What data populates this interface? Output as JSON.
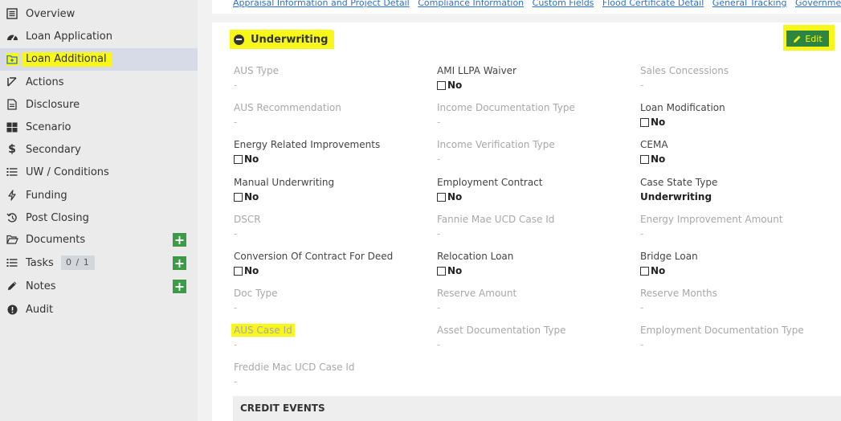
{
  "sidebar": {
    "items": [
      {
        "label": "Overview",
        "icon": "list-alt-icon"
      },
      {
        "label": "Loan Application",
        "icon": "tachometer-icon"
      },
      {
        "label": "Loan Additional",
        "icon": "folder-plus-icon"
      },
      {
        "label": "Actions",
        "icon": "arrow-up-right-icon"
      },
      {
        "label": "Disclosure",
        "icon": "document-icon"
      },
      {
        "label": "Scenario",
        "icon": "grid-icon"
      },
      {
        "label": "Secondary",
        "icon": "dollar-icon"
      },
      {
        "label": "UW / Conditions",
        "icon": "list-icon"
      },
      {
        "label": "Funding",
        "icon": "bolt-icon"
      },
      {
        "label": "Post Closing",
        "icon": "history-icon"
      },
      {
        "label": "Documents",
        "icon": "folder-open-icon"
      },
      {
        "label": "Tasks",
        "icon": "tasks-icon",
        "badge": "0 / 1"
      },
      {
        "label": "Notes",
        "icon": "pencil-icon"
      },
      {
        "label": "Audit",
        "icon": "alert-circle-icon"
      }
    ],
    "add_symbol": "+"
  },
  "topnav": {
    "links": [
      "Appraisal Information and Project Detail",
      "Compliance Information",
      "Custom Fields",
      "Flood Certificate Detail",
      "General Tracking",
      "Government"
    ]
  },
  "section": {
    "title": "Underwriting",
    "edit_label": "Edit"
  },
  "fields": {
    "aus_type": {
      "label": "AUS Type",
      "value": "-"
    },
    "ami_llpa_waiver": {
      "label": "AMI LLPA Waiver",
      "value": "No"
    },
    "sales_concessions": {
      "label": "Sales Concessions",
      "value": "-"
    },
    "aus_recommendation": {
      "label": "AUS Recommendation",
      "value": "-"
    },
    "income_doc_type": {
      "label": "Income Documentation Type",
      "value": "-"
    },
    "loan_modification": {
      "label": "Loan Modification",
      "value": "No"
    },
    "energy_improvements": {
      "label": "Energy Related Improvements",
      "value": "No"
    },
    "income_verification_type": {
      "label": "Income Verification Type",
      "value": "-"
    },
    "cema": {
      "label": "CEMA",
      "value": "No"
    },
    "manual_underwriting": {
      "label": "Manual Underwriting",
      "value": "No"
    },
    "employment_contract": {
      "label": "Employment Contract",
      "value": "No"
    },
    "case_state_type": {
      "label": "Case State Type",
      "value": "Underwriting"
    },
    "dscr": {
      "label": "DSCR",
      "value": "-"
    },
    "fannie_mae_ucd_case_id": {
      "label": "Fannie Mae UCD Case Id",
      "value": "-"
    },
    "energy_improvement_amount": {
      "label": "Energy Improvement Amount",
      "value": "-"
    },
    "conversion_contract_for_deed": {
      "label": "Conversion Of Contract For Deed",
      "value": "No"
    },
    "relocation_loan": {
      "label": "Relocation Loan",
      "value": "No"
    },
    "bridge_loan": {
      "label": "Bridge Loan",
      "value": "No"
    },
    "doc_type": {
      "label": "Doc Type",
      "value": "-"
    },
    "reserve_amount": {
      "label": "Reserve Amount",
      "value": "-"
    },
    "reserve_months": {
      "label": "Reserve Months",
      "value": "-"
    },
    "aus_case_id": {
      "label": "AUS Case Id",
      "value": "-"
    },
    "asset_doc_type": {
      "label": "Asset Documentation Type",
      "value": "-"
    },
    "employment_doc_type": {
      "label": "Employment Documentation Type",
      "value": "-"
    },
    "freddie_mac_ucd_case_id": {
      "label": "Freddie Mac UCD Case Id",
      "value": "-"
    }
  },
  "credit_events": {
    "title": "CREDIT EVENTS"
  },
  "colors": {
    "highlight": "#f7f71a",
    "edit_button": "#2e8540",
    "add_button": "#3c9c46",
    "link": "#2a6fd1",
    "active_sidebar": "#d7dbe8"
  }
}
